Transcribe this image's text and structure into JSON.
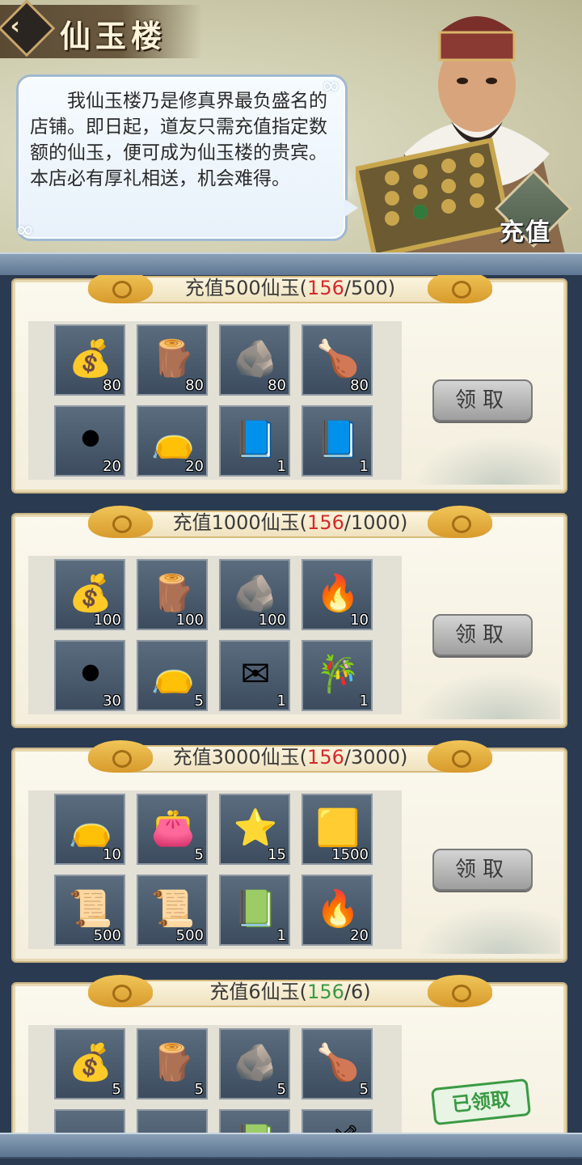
{
  "header": {
    "title": "仙玉楼",
    "back_icon": "chevron-left-icon",
    "speech": "我仙玉楼乃是修真界最负盛名的店铺。即日起，道友只需充值指定数额的仙玉，便可成为仙玉楼的贵宾。本店必有厚礼相送，机会难得。",
    "recharge_label": "充值"
  },
  "tiers": [
    {
      "label_prefix": "充值500仙玉(",
      "current": "156",
      "label_suffix": "/500)",
      "button": "领取",
      "items": [
        {
          "icon": "crystal-bag-icon",
          "glyph": "💰",
          "count": "80"
        },
        {
          "icon": "wood-logs-icon",
          "glyph": "🪵",
          "count": "80"
        },
        {
          "icon": "ore-crystal-icon",
          "glyph": "🪨",
          "count": "80"
        },
        {
          "icon": "roast-duck-icon",
          "glyph": "🍗",
          "count": "80"
        },
        {
          "icon": "dark-orb-icon",
          "glyph": "⚫",
          "count": "20"
        },
        {
          "icon": "green-pouch-icon",
          "glyph": "👝",
          "count": "20"
        },
        {
          "icon": "blue-book-icon",
          "glyph": "📘",
          "count": "1"
        },
        {
          "icon": "blue-book-icon",
          "glyph": "📘",
          "count": "1"
        }
      ]
    },
    {
      "label_prefix": "充值1000仙玉(",
      "current": "156",
      "label_suffix": "/1000)",
      "button": "领取",
      "items": [
        {
          "icon": "crystal-bag-icon",
          "glyph": "💰",
          "count": "100"
        },
        {
          "icon": "wood-logs-icon",
          "glyph": "🪵",
          "count": "100"
        },
        {
          "icon": "ore-crystal-icon",
          "glyph": "🪨",
          "count": "100"
        },
        {
          "icon": "purple-flame-icon",
          "glyph": "🔥",
          "count": "10"
        },
        {
          "icon": "dark-orb-icon",
          "glyph": "⚫",
          "count": "30"
        },
        {
          "icon": "blue-pouch-icon",
          "glyph": "👝",
          "count": "5"
        },
        {
          "icon": "letter-icon",
          "glyph": "✉",
          "count": "1"
        },
        {
          "icon": "jade-flute-icon",
          "glyph": "🎋",
          "count": "1"
        }
      ]
    },
    {
      "label_prefix": "充值3000仙玉(",
      "current": "156",
      "label_suffix": "/3000)",
      "button": "领取",
      "items": [
        {
          "icon": "blue-pouch-icon",
          "glyph": "👝",
          "count": "10"
        },
        {
          "icon": "red-pouch-icon",
          "glyph": "👛",
          "count": "5"
        },
        {
          "icon": "star-orb-icon",
          "glyph": "⭐",
          "count": "15"
        },
        {
          "icon": "gold-token-icon",
          "glyph": "🟨",
          "count": "1500"
        },
        {
          "icon": "pill-scroll-icon",
          "glyph": "📜",
          "count": "500"
        },
        {
          "icon": "artifact-scroll-icon",
          "glyph": "📜",
          "count": "500"
        },
        {
          "icon": "green-book-icon",
          "glyph": "📗",
          "count": "1"
        },
        {
          "icon": "purple-flame-icon",
          "glyph": "🔥",
          "count": "20"
        }
      ]
    },
    {
      "label_prefix": "充值6仙玉(",
      "current": "156",
      "label_suffix": "/6)",
      "button": "已领取",
      "claimed": true,
      "items": [
        {
          "icon": "crystal-bag-icon",
          "glyph": "💰",
          "count": "5"
        },
        {
          "icon": "wood-logs-icon",
          "glyph": "🪵",
          "count": "5"
        },
        {
          "icon": "ore-crystal-icon",
          "glyph": "🪨",
          "count": "5"
        },
        {
          "icon": "roast-duck-icon",
          "glyph": "🍗",
          "count": "5"
        },
        {
          "icon": "dark-orb-icon",
          "glyph": "⚫",
          "count": ""
        },
        {
          "icon": "green-pouch-icon",
          "glyph": "👝",
          "count": ""
        },
        {
          "icon": "green-book-icon",
          "glyph": "📗",
          "count": ""
        },
        {
          "icon": "sword-icon",
          "glyph": "🗡",
          "count": ""
        }
      ]
    }
  ],
  "colors": {
    "current_unmet": "#d22b2b",
    "current_met": "#3a9a44"
  }
}
